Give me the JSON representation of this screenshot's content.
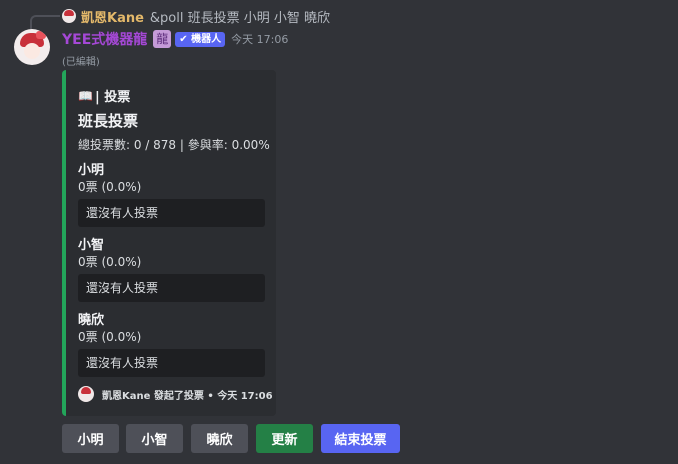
{
  "reply": {
    "author": "凱恩Kane",
    "content": "&poll 班長投票 小明 小智 曉欣"
  },
  "message": {
    "author": "YEE式機器龍",
    "role_icon": "龍",
    "bot_tag": "✔ 機器人",
    "timestamp": "今天 17:06",
    "edited_label": "(已編輯)"
  },
  "embed": {
    "accent_color": "#23a55a",
    "author_icon": "book-icon",
    "author_glyph": "📖",
    "author": "| 投票",
    "title": "班長投票",
    "description": "總投票數: 0 / 878 | 參與率: 0.00%",
    "fields": [
      {
        "name": "小明",
        "value": "0票 (0.0%)",
        "voters": "還沒有人投票"
      },
      {
        "name": "小智",
        "value": "0票 (0.0%)",
        "voters": "還沒有人投票"
      },
      {
        "name": "曉欣",
        "value": "0票 (0.0%)",
        "voters": "還沒有人投票"
      }
    ],
    "footer": "凱恩Kane 發起了投票 • 今天 17:06"
  },
  "buttons": [
    {
      "label": "小明",
      "style": "grey"
    },
    {
      "label": "小智",
      "style": "grey"
    },
    {
      "label": "曉欣",
      "style": "grey"
    },
    {
      "label": "更新",
      "style": "green"
    },
    {
      "label": "結束投票",
      "style": "blurple"
    }
  ]
}
